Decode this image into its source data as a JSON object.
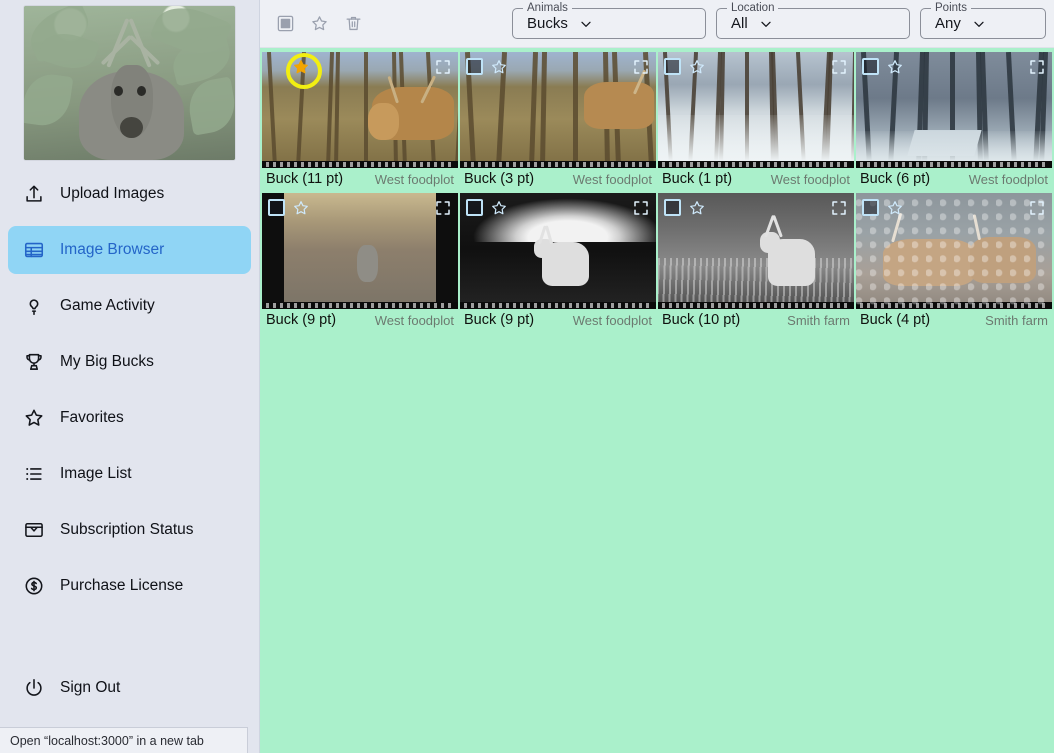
{
  "app": {
    "hero_alt": "buck-in-corn-header-photo"
  },
  "sidebar": {
    "items": [
      {
        "label": "Upload Images",
        "icon": "upload-icon",
        "name": "sidebar-item-upload-images",
        "active": false
      },
      {
        "label": "Image Browser",
        "icon": "table-icon",
        "name": "sidebar-item-image-browser",
        "active": true
      },
      {
        "label": "Game Activity",
        "icon": "lightbulb-icon",
        "name": "sidebar-item-game-activity",
        "active": false
      },
      {
        "label": "My Big Bucks",
        "icon": "trophy-icon",
        "name": "sidebar-item-my-big-bucks",
        "active": false
      },
      {
        "label": "Favorites",
        "icon": "star-icon",
        "name": "sidebar-item-favorites",
        "active": false
      },
      {
        "label": "Image List",
        "icon": "list-icon",
        "name": "sidebar-item-image-list",
        "active": false
      },
      {
        "label": "Subscription Status",
        "icon": "inbox-icon",
        "name": "sidebar-item-subscription-status",
        "active": false
      },
      {
        "label": "Purchase License",
        "icon": "dollar-circle-icon",
        "name": "sidebar-item-purchase-license",
        "active": false
      }
    ],
    "signout": {
      "label": "Sign Out",
      "icon": "power-icon"
    }
  },
  "statusbar": {
    "text": "Open “localhost:3000” in a new tab"
  },
  "toolbar": {
    "actions": [
      {
        "name": "select-all-checkbox",
        "icon": "checkbox-icon"
      },
      {
        "name": "favorite-button",
        "icon": "star-icon"
      },
      {
        "name": "delete-button",
        "icon": "trash-icon"
      }
    ],
    "filters": [
      {
        "legend": "Animals",
        "value": "Bucks",
        "name": "animals-filter"
      },
      {
        "legend": "Location",
        "value": "All",
        "name": "location-filter"
      },
      {
        "legend": "Points",
        "value": "Any",
        "name": "points-filter"
      }
    ]
  },
  "colors": {
    "content_bg": "#aaf0cb",
    "sidebar_bg": "#e2e5ee",
    "toolbar_bg": "#eef0f5",
    "active_item_bg": "#90d5f5",
    "active_item_fg": "#2465c8",
    "highlight_ring": "#f2ee12",
    "star_filled": "#f3a500"
  },
  "grid": {
    "images": [
      {
        "title": "Buck (11 pt)",
        "location": "West foodplot",
        "scene": "woods-brown",
        "starred": true,
        "highlighted": true,
        "checkbox_visible": false
      },
      {
        "title": "Buck (3 pt)",
        "location": "West foodplot",
        "scene": "woods-brown2",
        "starred": false,
        "highlighted": false,
        "checkbox_visible": true
      },
      {
        "title": "Buck (1 pt)",
        "location": "West foodplot",
        "scene": "snow",
        "starred": false,
        "highlighted": false,
        "checkbox_visible": true
      },
      {
        "title": "Buck (6 pt)",
        "location": "West foodplot",
        "scene": "snowdark",
        "starred": false,
        "highlighted": false,
        "checkbox_visible": true
      },
      {
        "title": "Buck (9 pt)",
        "location": "West foodplot",
        "scene": "fall-dark",
        "starred": false,
        "highlighted": false,
        "checkbox_visible": true
      },
      {
        "title": "Buck (9 pt)",
        "location": "West foodplot",
        "scene": "ir",
        "starred": false,
        "highlighted": false,
        "checkbox_visible": true
      },
      {
        "title": "Buck (10 pt)",
        "location": "Smith farm",
        "scene": "ir2",
        "starred": false,
        "highlighted": false,
        "checkbox_visible": true
      },
      {
        "title": "Buck (4 pt)",
        "location": "Smith farm",
        "scene": "rock",
        "starred": false,
        "highlighted": false,
        "checkbox_visible": true
      }
    ]
  }
}
